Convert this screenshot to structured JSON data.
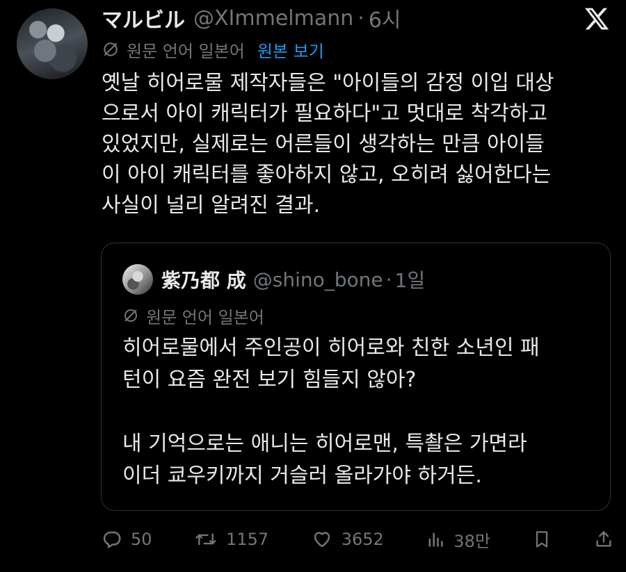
{
  "tweet": {
    "display_name": "マルビル",
    "handle": "@XImmelmann",
    "separator": "·",
    "time": "6시",
    "translation": {
      "icon": "no-translate-icon",
      "source_label": "원문 언어 일본어",
      "view_original_link": "원본 보기"
    },
    "body_lines": [
      "옛날 히어로물 제작자들은 \"아이들의 감정 이입 대상",
      "으로서 아이 캐릭터가 필요하다\"고 멋대로 착각하고",
      "있었지만, 실제로는 어른들이 생각하는 만큼 아이들",
      "이 아이 캐릭터를 좋아하지 않고, 오히려 싫어한다는",
      "사실이 널리 알려진 결과."
    ]
  },
  "quoted_tweet": {
    "display_name": "紫乃都 成",
    "handle": "@shino_bone",
    "separator": "·",
    "time": "1일",
    "translation": {
      "icon": "no-translate-icon",
      "source_label": "원문 언어 일본어"
    },
    "body_lines": [
      "히어로물에서 주인공이 히어로와 친한 소년인 패",
      "턴이 요즘 완전 보기 힘들지 않아?",
      "",
      "내 기억으로는 애니는 히어로맨, 특촬은 가면라",
      "이더 쿄우키까지 거슬러 올라가야 하거든."
    ]
  },
  "actions": {
    "reply": {
      "icon": "reply-icon",
      "count": "50"
    },
    "retweet": {
      "icon": "retweet-icon",
      "count": "1157"
    },
    "like": {
      "icon": "heart-icon",
      "count": "3652"
    },
    "views": {
      "icon": "views-icon",
      "count": "38만"
    },
    "bookmark": {
      "icon": "bookmark-icon"
    },
    "share": {
      "icon": "share-icon"
    }
  },
  "colors": {
    "background": "#000000",
    "text": "#e7e9ea",
    "muted": "#71767b",
    "link": "#1d9bf0",
    "border": "#2f3336"
  },
  "logo": {
    "icon": "x-logo-icon"
  }
}
